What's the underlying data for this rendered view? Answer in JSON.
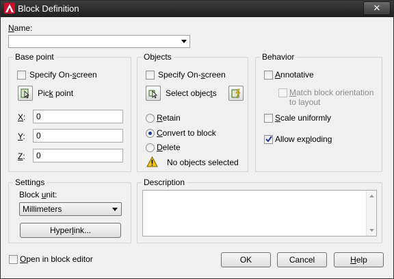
{
  "window": {
    "title": "Block Definition",
    "close_glyph": "✕"
  },
  "name": {
    "label_u": "N",
    "label_rest": "ame:",
    "value": ""
  },
  "base_point": {
    "title": "Base point",
    "specify_onscreen": {
      "pre": "Specify On-",
      "u": "s",
      "post": "creen",
      "checked": false
    },
    "pick_point": {
      "pre": "Pic",
      "u": "k",
      "post": " point",
      "icon": "pick-point-icon"
    },
    "x": {
      "label_u": "X",
      "label_rest": ":",
      "value": "0"
    },
    "y": {
      "label_u": "Y",
      "label_rest": ":",
      "value": "0"
    },
    "z": {
      "label_u": "Z",
      "label_rest": ":",
      "value": "0"
    }
  },
  "objects": {
    "title": "Objects",
    "specify_onscreen": {
      "pre": "Specify On-",
      "u": "s",
      "post": "creen",
      "checked": false
    },
    "select_objects": {
      "pre": "Select objec",
      "u": "t",
      "post": "s",
      "icon": "select-objects-icon"
    },
    "quick_select_icon": "quick-select-icon",
    "retain": {
      "pre": "",
      "u": "R",
      "post": "etain",
      "selected": false
    },
    "convert": {
      "pre": "",
      "u": "C",
      "post": "onvert to block",
      "selected": true
    },
    "delete": {
      "pre": "",
      "u": "D",
      "post": "elete",
      "selected": false
    },
    "status": "No objects selected",
    "status_icon": "warning-icon"
  },
  "behavior": {
    "title": "Behavior",
    "annotative": {
      "pre": "",
      "u": "A",
      "post": "nnotative",
      "checked": false
    },
    "match_orientation": {
      "line1_pre": "",
      "line1_u": "M",
      "line1_post": "atch block orientation",
      "line2": "to layout",
      "checked": false,
      "enabled": false
    },
    "scale_uniformly": {
      "pre": "",
      "u": "S",
      "post": "cale uniformly",
      "checked": false
    },
    "allow_exploding": {
      "pre": "Allow ex",
      "u": "p",
      "post": "loding",
      "checked": true
    }
  },
  "settings": {
    "title": "Settings",
    "block_unit_label": {
      "pre": "Block ",
      "u": "u",
      "post": "nit:"
    },
    "block_unit_value": "Millimeters",
    "hyperlink": {
      "pre": "Hyper",
      "u": "l",
      "post": "ink..."
    }
  },
  "description": {
    "title": "Description",
    "value": ""
  },
  "footer": {
    "open_in_editor": {
      "pre": "",
      "u": "O",
      "post": "pen in block editor",
      "checked": false
    },
    "ok": "OK",
    "cancel": "Cancel",
    "help": {
      "pre": "",
      "u": "H",
      "post": "elp"
    }
  },
  "colors": {
    "title_bar": "#2a2a2a",
    "app_icon": "#c8102e",
    "warning": "#f2c811",
    "radio_dot": "#1f3a93"
  }
}
